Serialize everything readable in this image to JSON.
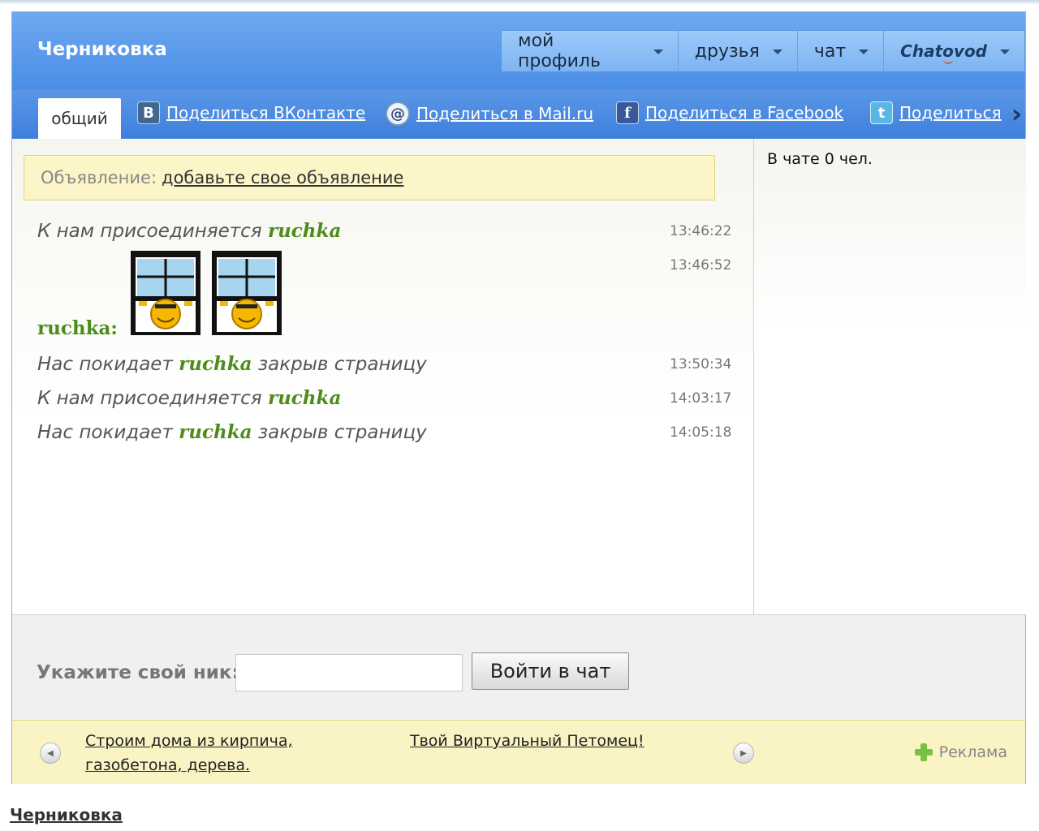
{
  "chat_title": "Черниковка",
  "nav": {
    "profile": "мой профиль",
    "friends": "друзья",
    "chat": "чат",
    "brand": "Chatovod"
  },
  "tabs": {
    "general": "общий",
    "share_vk": "Поделиться ВКонтакте",
    "share_mail": "Поделиться в Mail.ru",
    "share_facebook": "Поделиться в Facebook",
    "share_twitter": "Поделиться"
  },
  "announcement": {
    "label": "Объявление:",
    "link": "добавьте свое объявление"
  },
  "messages": [
    {
      "prefix": "К нам присоединяется ",
      "nick": "ruchka",
      "suffix": "",
      "time": "13:46:22"
    },
    {
      "user": "ruchka:",
      "time": "13:46:52",
      "content": "smiley-window-icon x2"
    },
    {
      "prefix": "Нас покидает ",
      "nick": "ruchka",
      "suffix": " закрыв страницу",
      "time": "13:50:34"
    },
    {
      "prefix": "К нам присоединяется ",
      "nick": "ruchka",
      "suffix": "",
      "time": "14:03:17"
    },
    {
      "prefix": "Нас покидает ",
      "nick": "ruchka",
      "suffix": " закрыв страницу",
      "time": "14:05:18"
    }
  ],
  "sidebar": {
    "online_count": "В чате 0 чел."
  },
  "login": {
    "label": "Укажите свой ник:",
    "nick_value": "",
    "button": "Войти в чат"
  },
  "ads": {
    "ad1_line1": "Строим дома из кирпича,",
    "ad1_line2": "газобетона, дерева.",
    "ad2": "Твой Виртуальный Петомец!",
    "label": "Реклама"
  },
  "footer": {
    "link": "Черниковка"
  },
  "colors": {
    "header_blue": "#4a8ee6",
    "nick_green": "#4e8c1a",
    "announce_bg": "#fbf5c7"
  }
}
